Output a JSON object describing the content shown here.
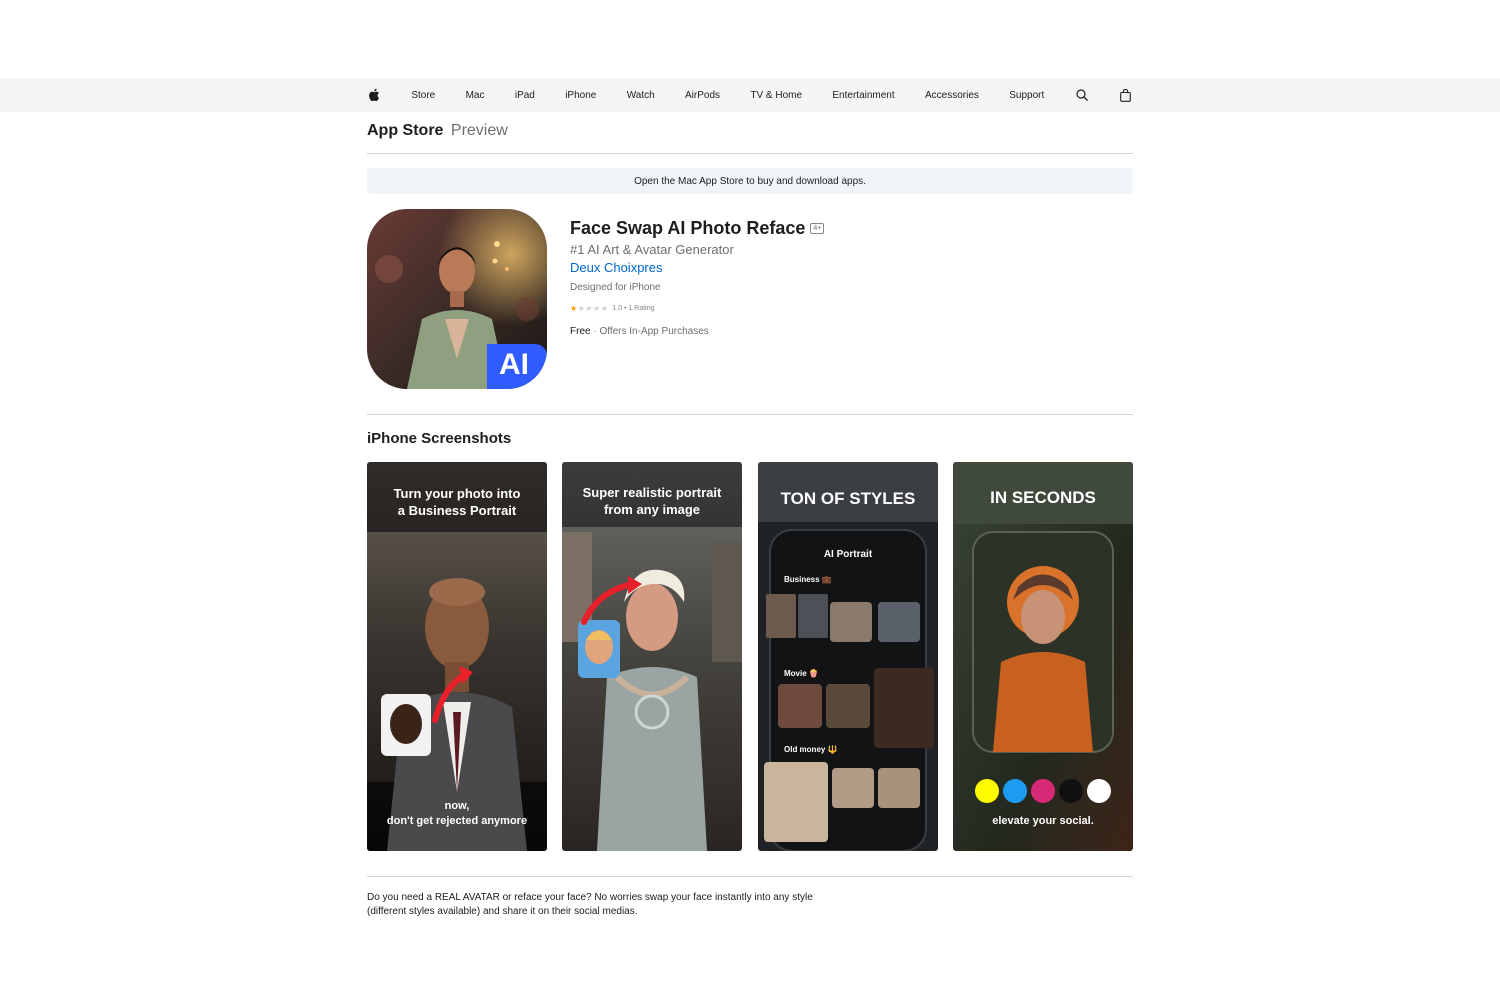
{
  "nav": {
    "items": [
      "Store",
      "Mac",
      "iPad",
      "iPhone",
      "Watch",
      "AirPods",
      "TV & Home",
      "Entertainment",
      "Accessories",
      "Support"
    ],
    "logo_icon": "apple-logo-icon",
    "search_icon": "search-icon",
    "bag_icon": "shopping-bag-icon"
  },
  "localnav": {
    "title": "App Store",
    "subtitle": "Preview"
  },
  "banner": {
    "text": "Open the Mac App Store to buy and download apps."
  },
  "app": {
    "title": "Face Swap AI Photo Reface",
    "age_rating": "4+",
    "subtitle": "#1 AI Art & Avatar Generator",
    "developer": "Deux Choixpres",
    "designed_for": "Designed for iPhone",
    "rating_value": 1.0,
    "rating_text": "1.0 • 1 Rating",
    "price": "Free",
    "iap": "Offers In-App Purchases",
    "icon_badge": "AI",
    "icon_colors": {
      "badge": "#2f5bff",
      "bg": "#3a2a24"
    }
  },
  "screenshots": {
    "title": "iPhone Screenshots",
    "items": [
      {
        "top_line1": "Turn your photo into",
        "top_line2": "a Business Portrait",
        "bottom_line1": "now,",
        "bottom_line2": "don't get rejected anymore"
      },
      {
        "top_line1": "Super realistic portrait",
        "top_line2": "from any image"
      },
      {
        "headline": "TON OF STYLES",
        "panel_title": "AI Portrait",
        "cat1": "Business 💼",
        "cat2": "Movie 🍿",
        "cat3": "Old money 🔱"
      },
      {
        "headline": "IN SECONDS",
        "bottom_line": "elevate your social."
      }
    ]
  },
  "description": {
    "line1": "Do you need a REAL AVATAR or reface your face? No worries swap your face instantly into any style",
    "line2": "(different styles available) and share it on their social medias."
  }
}
